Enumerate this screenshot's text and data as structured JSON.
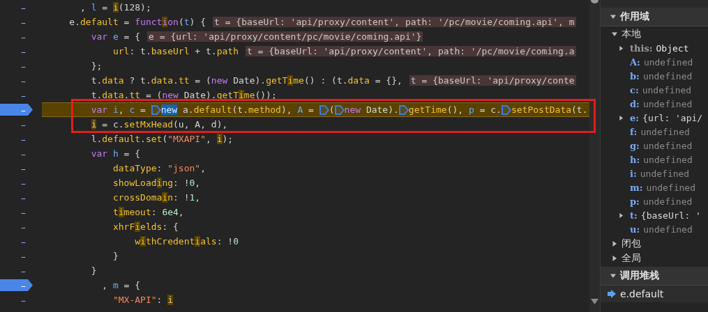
{
  "editor": {
    "lines": [
      {
        "gutter": "–",
        "breakpoint": false,
        "paused": false,
        "boxed": false,
        "tokens": [
          {
            "kind": "p",
            "t": "      , "
          },
          {
            "kind": "v",
            "t": "l"
          },
          {
            "kind": "p",
            "t": " = "
          },
          {
            "kind": "match",
            "t": "i"
          },
          {
            "kind": "p",
            "t": "(128);"
          }
        ]
      },
      {
        "gutter": "–",
        "breakpoint": false,
        "paused": false,
        "boxed": false,
        "tokens": [
          {
            "kind": "p",
            "t": "    e."
          },
          {
            "kind": "f",
            "t": "default"
          },
          {
            "kind": "p",
            "t": " = "
          },
          {
            "kind": "k",
            "parts": [
              "funct",
              "i",
              "on"
            ]
          },
          {
            "kind": "p",
            "t": "("
          },
          {
            "kind": "v",
            "t": "t"
          },
          {
            "kind": "p",
            "t": ") {"
          },
          {
            "kind": "inline",
            "t": "t = {baseUrl: 'api/proxy/content', path: '/pc/movie/coming.api', m"
          }
        ]
      },
      {
        "gutter": "–",
        "breakpoint": false,
        "paused": false,
        "boxed": false,
        "tokens": [
          {
            "kind": "k",
            "t": "        var"
          },
          {
            "kind": "v",
            "t": " e"
          },
          {
            "kind": "p",
            "t": " = {"
          },
          {
            "kind": "inline",
            "t": "e = {url: 'api/proxy/content/pc/movie/coming.api'}"
          }
        ]
      },
      {
        "gutter": "–",
        "breakpoint": false,
        "paused": false,
        "boxed": false,
        "tokens": [
          {
            "kind": "f",
            "t": "            url"
          },
          {
            "kind": "p",
            "t": ": t."
          },
          {
            "kind": "f",
            "t": "baseUrl"
          },
          {
            "kind": "p",
            "t": " + t."
          },
          {
            "kind": "f",
            "t": "path"
          },
          {
            "kind": "inline",
            "t": "t = {baseUrl: 'api/proxy/content', path: '/pc/movie/coming.a"
          }
        ]
      },
      {
        "gutter": "–",
        "breakpoint": false,
        "paused": false,
        "boxed": false,
        "tokens": [
          {
            "kind": "p",
            "t": "        };"
          }
        ]
      },
      {
        "gutter": "–",
        "breakpoint": false,
        "paused": false,
        "boxed": false,
        "tokens": [
          {
            "kind": "p",
            "t": "        t."
          },
          {
            "kind": "f",
            "t": "data"
          },
          {
            "kind": "p",
            "t": " ? t."
          },
          {
            "kind": "f",
            "t": "data"
          },
          {
            "kind": "p",
            "t": "."
          },
          {
            "kind": "f",
            "t": "tt"
          },
          {
            "kind": "p",
            "t": " = ("
          },
          {
            "kind": "k",
            "t": "new"
          },
          {
            "kind": "p",
            "t": " Date)."
          },
          {
            "kind": "f",
            "parts": [
              "getT",
              "i",
              "me"
            ]
          },
          {
            "kind": "p",
            "t": "() : (t."
          },
          {
            "kind": "f",
            "t": "data"
          },
          {
            "kind": "p",
            "t": " = {},"
          },
          {
            "kind": "inline",
            "t": "t = {baseUrl: 'api/proxy/conte"
          }
        ]
      },
      {
        "gutter": "–",
        "breakpoint": false,
        "paused": false,
        "boxed": false,
        "tokens": [
          {
            "kind": "p",
            "t": "        t."
          },
          {
            "kind": "f",
            "t": "data"
          },
          {
            "kind": "p",
            "t": "."
          },
          {
            "kind": "f",
            "t": "tt"
          },
          {
            "kind": "p",
            "t": " = ("
          },
          {
            "kind": "k",
            "t": "new"
          },
          {
            "kind": "p",
            "t": " Date)."
          },
          {
            "kind": "f",
            "parts": [
              "getT",
              "i",
              "me"
            ]
          },
          {
            "kind": "p",
            "t": "());"
          }
        ]
      },
      {
        "gutter": "–",
        "breakpoint": true,
        "paused": true,
        "boxed": true,
        "tokens": [
          {
            "kind": "k",
            "t": "        var"
          },
          {
            "kind": "v",
            "t": " i"
          },
          {
            "kind": "p",
            "t": ", "
          },
          {
            "kind": "v",
            "t": "c"
          },
          {
            "kind": "p",
            "t": " = "
          },
          {
            "kind": "step"
          },
          {
            "kind": "cur",
            "t": "new"
          },
          {
            "kind": "p",
            "t": " a."
          },
          {
            "kind": "f",
            "t": "default"
          },
          {
            "kind": "p",
            "t": "(t."
          },
          {
            "kind": "f",
            "t": "method"
          },
          {
            "kind": "p",
            "t": "), "
          },
          {
            "kind": "v",
            "t": "A"
          },
          {
            "kind": "p",
            "t": " = "
          },
          {
            "kind": "step"
          },
          {
            "kind": "p",
            "t": "("
          },
          {
            "kind": "step"
          },
          {
            "kind": "k",
            "t": "new"
          },
          {
            "kind": "p",
            "t": " Date)."
          },
          {
            "kind": "step"
          },
          {
            "kind": "f",
            "t": "getTime"
          },
          {
            "kind": "p",
            "t": "(), "
          },
          {
            "kind": "v",
            "t": "p"
          },
          {
            "kind": "p",
            "t": " = c."
          },
          {
            "kind": "step"
          },
          {
            "kind": "f",
            "t": "setPostData"
          },
          {
            "kind": "p",
            "t": "(t."
          }
        ]
      },
      {
        "gutter": "–",
        "breakpoint": false,
        "paused": false,
        "boxed": true,
        "tokens": [
          {
            "kind": "match",
            "t": "        i"
          },
          {
            "kind": "p",
            "t": " = c."
          },
          {
            "kind": "f",
            "t": "setMxHead"
          },
          {
            "kind": "p",
            "t": "(u, A, d),"
          }
        ]
      },
      {
        "gutter": "–",
        "breakpoint": false,
        "paused": false,
        "boxed": false,
        "tokens": [
          {
            "kind": "p",
            "t": "        l."
          },
          {
            "kind": "f",
            "t": "default"
          },
          {
            "kind": "p",
            "t": "."
          },
          {
            "kind": "f",
            "t": "set"
          },
          {
            "kind": "p",
            "t": "("
          },
          {
            "kind": "s",
            "t": "\"MXAPI\""
          },
          {
            "kind": "p",
            "t": ", "
          },
          {
            "kind": "match",
            "t": "i"
          },
          {
            "kind": "p",
            "t": ");"
          }
        ]
      },
      {
        "gutter": "–",
        "breakpoint": false,
        "paused": false,
        "boxed": false,
        "tokens": [
          {
            "kind": "k",
            "t": "        var"
          },
          {
            "kind": "v",
            "t": " h"
          },
          {
            "kind": "p",
            "t": " = {"
          }
        ]
      },
      {
        "gutter": "–",
        "breakpoint": false,
        "paused": false,
        "boxed": false,
        "tokens": [
          {
            "kind": "f",
            "t": "            dataType"
          },
          {
            "kind": "p",
            "t": ": "
          },
          {
            "kind": "s",
            "t": "\"json\""
          },
          {
            "kind": "p",
            "t": ","
          }
        ]
      },
      {
        "gutter": "–",
        "breakpoint": false,
        "paused": false,
        "boxed": false,
        "tokens": [
          {
            "kind": "f",
            "parts": [
              "            showLoad",
              "i",
              "ng"
            ]
          },
          {
            "kind": "p",
            "t": ": !"
          },
          {
            "kind": "n",
            "t": "0"
          },
          {
            "kind": "p",
            "t": ","
          }
        ]
      },
      {
        "gutter": "–",
        "breakpoint": false,
        "paused": false,
        "boxed": false,
        "tokens": [
          {
            "kind": "f",
            "parts": [
              "            crossDoma",
              "i",
              "n"
            ]
          },
          {
            "kind": "p",
            "t": ": !"
          },
          {
            "kind": "n",
            "t": "1"
          },
          {
            "kind": "p",
            "t": ","
          }
        ]
      },
      {
        "gutter": "–",
        "breakpoint": false,
        "paused": false,
        "boxed": false,
        "tokens": [
          {
            "kind": "f",
            "parts": [
              "            t",
              "i",
              "meout"
            ]
          },
          {
            "kind": "p",
            "t": ": "
          },
          {
            "kind": "n",
            "t": "6e4"
          },
          {
            "kind": "p",
            "t": ","
          }
        ]
      },
      {
        "gutter": "–",
        "breakpoint": false,
        "paused": false,
        "boxed": false,
        "tokens": [
          {
            "kind": "f",
            "parts": [
              "            xhrF",
              "i",
              "elds"
            ]
          },
          {
            "kind": "p",
            "t": ": {"
          }
        ]
      },
      {
        "gutter": "–",
        "breakpoint": false,
        "paused": false,
        "boxed": false,
        "tokens": [
          {
            "kind": "f",
            "parts": [
              "                w",
              "i",
              "thCredent",
              "i",
              "als"
            ]
          },
          {
            "kind": "p",
            "t": ": !"
          },
          {
            "kind": "n",
            "t": "0"
          }
        ]
      },
      {
        "gutter": "–",
        "breakpoint": false,
        "paused": false,
        "boxed": false,
        "tokens": [
          {
            "kind": "p",
            "t": "            }"
          }
        ]
      },
      {
        "gutter": "–",
        "breakpoint": false,
        "paused": false,
        "boxed": false,
        "tokens": [
          {
            "kind": "p",
            "t": "        }"
          }
        ]
      },
      {
        "gutter": "–",
        "breakpoint": true,
        "paused": false,
        "boxed": false,
        "tokens": [
          {
            "kind": "p",
            "t": "          , "
          },
          {
            "kind": "v",
            "t": "m"
          },
          {
            "kind": "p",
            "t": " = {"
          }
        ]
      },
      {
        "gutter": "–",
        "breakpoint": false,
        "paused": false,
        "boxed": false,
        "tokens": [
          {
            "kind": "s",
            "t": "            \"MX-API\""
          },
          {
            "kind": "p",
            "t": ": "
          },
          {
            "kind": "match",
            "t": "i"
          }
        ]
      }
    ]
  },
  "scope": {
    "title": "作用域",
    "expanded": true,
    "groups": [
      {
        "label": "本地",
        "expanded": true,
        "vars": [
          {
            "name": "this:",
            "value": "Object",
            "kind": "receiver",
            "expandable": true
          },
          {
            "name": "A:",
            "value": "undefined",
            "kind": "undefined",
            "expandable": false
          },
          {
            "name": "b:",
            "value": "undefined",
            "kind": "undefined",
            "expandable": false
          },
          {
            "name": "c:",
            "value": "undefined",
            "kind": "undefined",
            "expandable": false
          },
          {
            "name": "d:",
            "value": "undefined",
            "kind": "undefined",
            "expandable": false
          },
          {
            "name": "e:",
            "value": "{url: 'api/",
            "kind": "object",
            "expandable": true
          },
          {
            "name": "f:",
            "value": "undefined",
            "kind": "undefined",
            "expandable": false
          },
          {
            "name": "g:",
            "value": "undefined",
            "kind": "undefined",
            "expandable": false
          },
          {
            "name": "h:",
            "value": "undefined",
            "kind": "undefined",
            "expandable": false
          },
          {
            "name": "i:",
            "value": "undefined",
            "kind": "undefined",
            "expandable": false
          },
          {
            "name": "m:",
            "value": "undefined",
            "kind": "undefined",
            "expandable": false
          },
          {
            "name": "p:",
            "value": "undefined",
            "kind": "undefined",
            "expandable": false
          },
          {
            "name": "t:",
            "value": "{baseUrl: '",
            "kind": "object",
            "expandable": true
          },
          {
            "name": "u:",
            "value": "undefined",
            "kind": "undefined",
            "expandable": false
          }
        ]
      },
      {
        "label": "闭包",
        "expanded": false
      },
      {
        "label": "全局",
        "expanded": false
      }
    ]
  },
  "call_stack": {
    "title": "调用堆栈",
    "expanded": true,
    "frames": [
      {
        "name": "e.default",
        "selected": true
      }
    ]
  }
}
